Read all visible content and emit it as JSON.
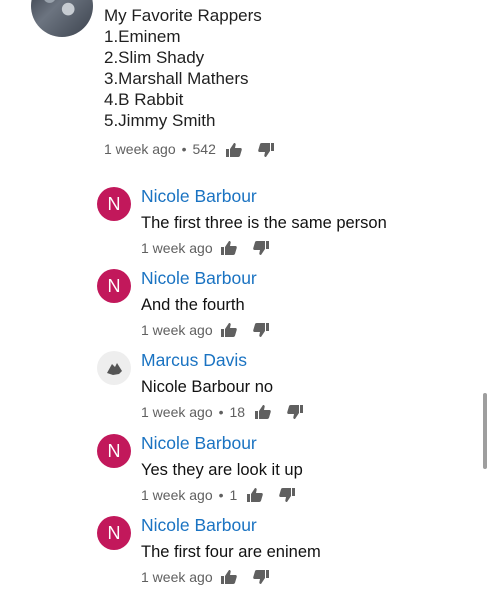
{
  "comment": {
    "lines": [
      "My Favorite Rappers",
      "1.Eminem",
      "2.Slim Shady",
      "3.Marshall Mathers",
      "4.B Rabbit",
      "5.Jimmy Smith"
    ],
    "time": "1 week ago",
    "separator": "•",
    "likes": "542"
  },
  "replies": [
    {
      "initial": "N",
      "author": "Nicole Barbour",
      "text": "The first three is the same person",
      "time": "1 week ago",
      "likes": ""
    },
    {
      "initial": "N",
      "author": "Nicole Barbour",
      "text": "And the fourth",
      "time": "1 week ago",
      "likes": ""
    },
    {
      "initial": "",
      "author": "Marcus Davis",
      "text": "Nicole Barbour no",
      "time": "1 week ago",
      "likes": "18"
    },
    {
      "initial": "N",
      "author": "Nicole Barbour",
      "text": "Yes they are look it up",
      "time": "1 week ago",
      "likes": "1"
    },
    {
      "initial": "N",
      "author": "Nicole Barbour",
      "text": "The first four are eninem",
      "time": "1 week ago",
      "likes": ""
    }
  ],
  "colors": {
    "author": "#1a73c2",
    "avatar_n": "#c2185b",
    "meta": "#606060"
  },
  "icons": {
    "like": "thumbs-up-icon",
    "dislike": "thumbs-down-icon"
  }
}
